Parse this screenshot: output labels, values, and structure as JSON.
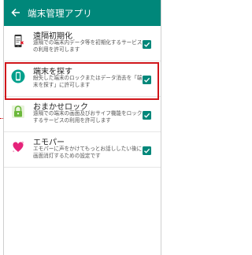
{
  "header": {
    "back_icon": "arrow-left-icon",
    "title": "端末管理アプリ"
  },
  "items": [
    {
      "name": "遠隔初期化",
      "desc": "遠隔での端末内データ等を初期化するサービスの利用を許可します",
      "icon": "smartphone-remote-wipe-icon",
      "checked": true
    },
    {
      "name": "端末を探す",
      "desc": "紛失した端末のロックまたはデータ消去を「端末を探す」に許可します",
      "icon": "find-device-icon",
      "checked": true,
      "highlighted": true
    },
    {
      "name": "おまかせロック",
      "desc": "遠隔での端末の画面及びおサイフ機能をロックするサービスの利用を許可します",
      "icon": "padlock-icon",
      "checked": true
    },
    {
      "name": "エモパー",
      "desc": "エモパーに声をかけてもっとお話ししたい後に画面消灯するための設定です",
      "icon": "emopa-heart-icon",
      "checked": true
    }
  ],
  "colors": {
    "accent": "#00877a",
    "highlight": "#d0161b",
    "emopa": "#e5237a",
    "lock": "#6bb83a"
  }
}
